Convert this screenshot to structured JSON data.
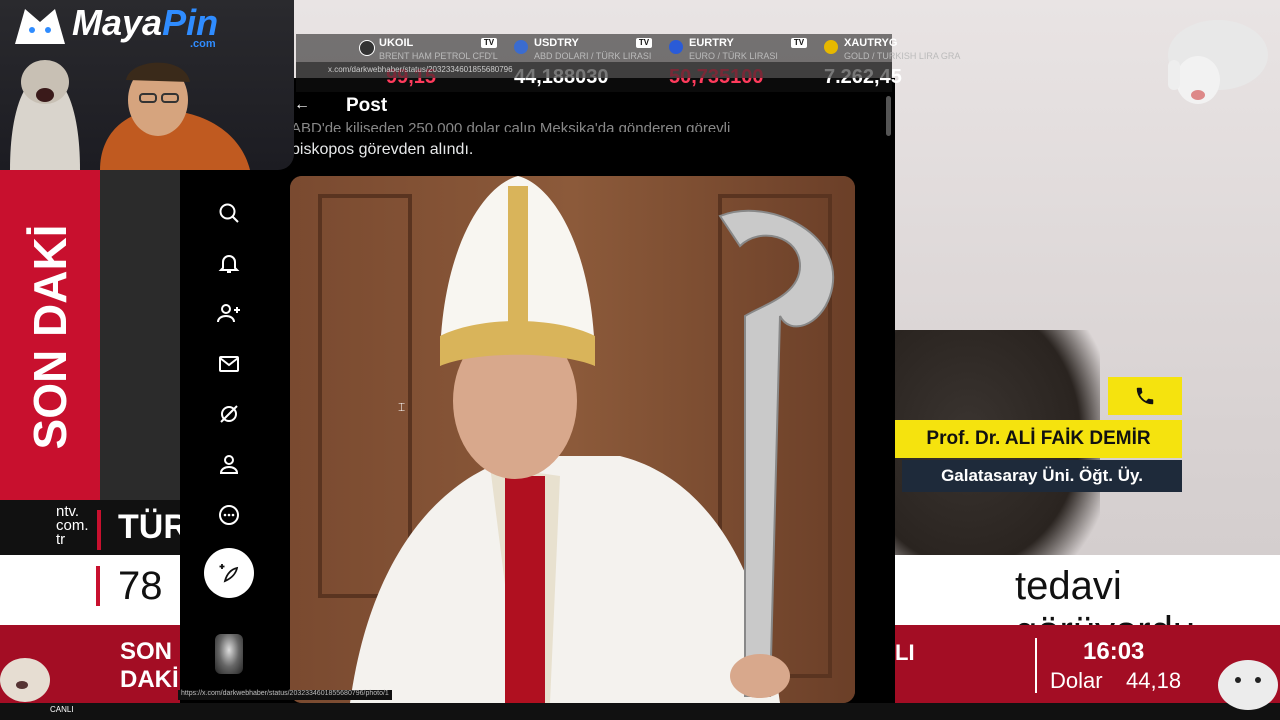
{
  "logo": {
    "maya": "Maya",
    "pin": "Pin",
    "com": ".com"
  },
  "ticker": [
    {
      "symbol": "UKOIL",
      "name": "BRENT HAM PETROL CFD'L",
      "value": "99,15",
      "color": "#ff3b5c",
      "dot": "#333"
    },
    {
      "symbol": "USDTRY",
      "name": "ABD DOLARI / TÜRK LIRASI",
      "value": "44,188030",
      "color": "#ffffff",
      "dot": "#3b6ccf"
    },
    {
      "symbol": "EURTRY",
      "name": "EURO / TÜRK LIRASI",
      "value": "50,735100",
      "color": "#ff3b5c",
      "dot": "#2a5bd7"
    },
    {
      "symbol": "XAUTRYG",
      "name": "GOLD / TURKISH LIRA GRA",
      "value": "7.262,45",
      "color": "#ffffff",
      "dot": "#e6b800"
    }
  ],
  "tv_icon": "TV",
  "browser": {
    "url": "x.com/darkwebhaber/status/2032334601855680796"
  },
  "x_post": {
    "header_title": "Post",
    "back_icon": "←",
    "text_line_1": "ABD'de kiliseden 250.000 dolar çalıp Meksika'da gönderen görevli",
    "text_line_2": "piskopos görevden alındı."
  },
  "status_url": "https://x.com/darkwebhaber/status/2032334601855680796/photo/1",
  "broadcast": {
    "vertical_label": "SON DAKİ",
    "ntv_logo": "ntv.\ncom.\ntr",
    "short_title": "TÜR",
    "headline_left": "78",
    "headline_right": "tedavi görüyordu",
    "bottom_son": "SON\nDAKİ",
    "bottom_li": "LI",
    "clock": "16:03",
    "dolar_label": "Dolar",
    "dolar_value": "44,18",
    "live_label": "CANLI"
  },
  "guest": {
    "name": "Prof. Dr. ALİ FAİK DEMİR",
    "title": "Galatasaray Üni. Öğt. Üy."
  },
  "colors": {
    "news_red": "#c8102e",
    "accent_yellow": "#f5e30e",
    "brand_blue": "#2f8cff"
  }
}
